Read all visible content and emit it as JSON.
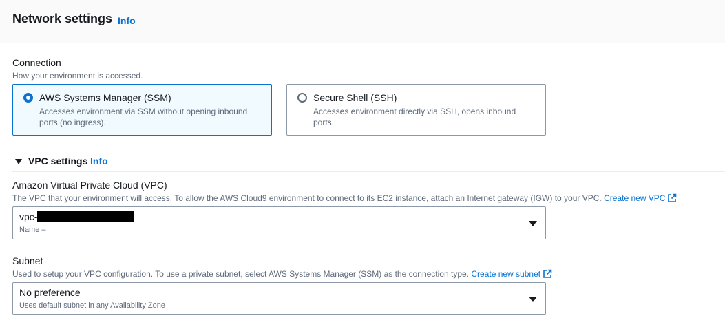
{
  "header": {
    "title": "Network settings",
    "info": "Info"
  },
  "connection": {
    "label": "Connection",
    "description": "How your environment is accessed.",
    "options": [
      {
        "title": "AWS Systems Manager (SSM)",
        "description": "Accesses environment via SSM without opening inbound ports (no ingress).",
        "selected": true
      },
      {
        "title": "Secure Shell (SSH)",
        "description": "Accesses environment directly via SSH, opens inbound ports.",
        "selected": false
      }
    ]
  },
  "vpc_settings": {
    "title": "VPC settings",
    "info": "Info",
    "expanded": true
  },
  "vpc": {
    "label": "Amazon Virtual Private Cloud (VPC)",
    "description": "The VPC that your environment will access. To allow the AWS Cloud9 environment to connect to its EC2 instance, attach an Internet gateway (IGW) to your VPC.",
    "create_link": "Create new VPC",
    "selected_value": "vpc-",
    "selected_sub": "Name –"
  },
  "subnet": {
    "label": "Subnet",
    "description": "Used to setup your VPC configuration. To use a private subnet, select AWS Systems Manager (SSM) as the connection type.",
    "create_link": "Create new subnet",
    "selected_value": "No preference",
    "selected_sub": "Uses default subnet in any Availability Zone"
  },
  "colors": {
    "link": "#0972d3",
    "selected_border": "#0972d3",
    "selected_bg": "#f1faff"
  },
  "icons": {
    "external": "external-link-icon",
    "caret": "caret-down-icon"
  }
}
